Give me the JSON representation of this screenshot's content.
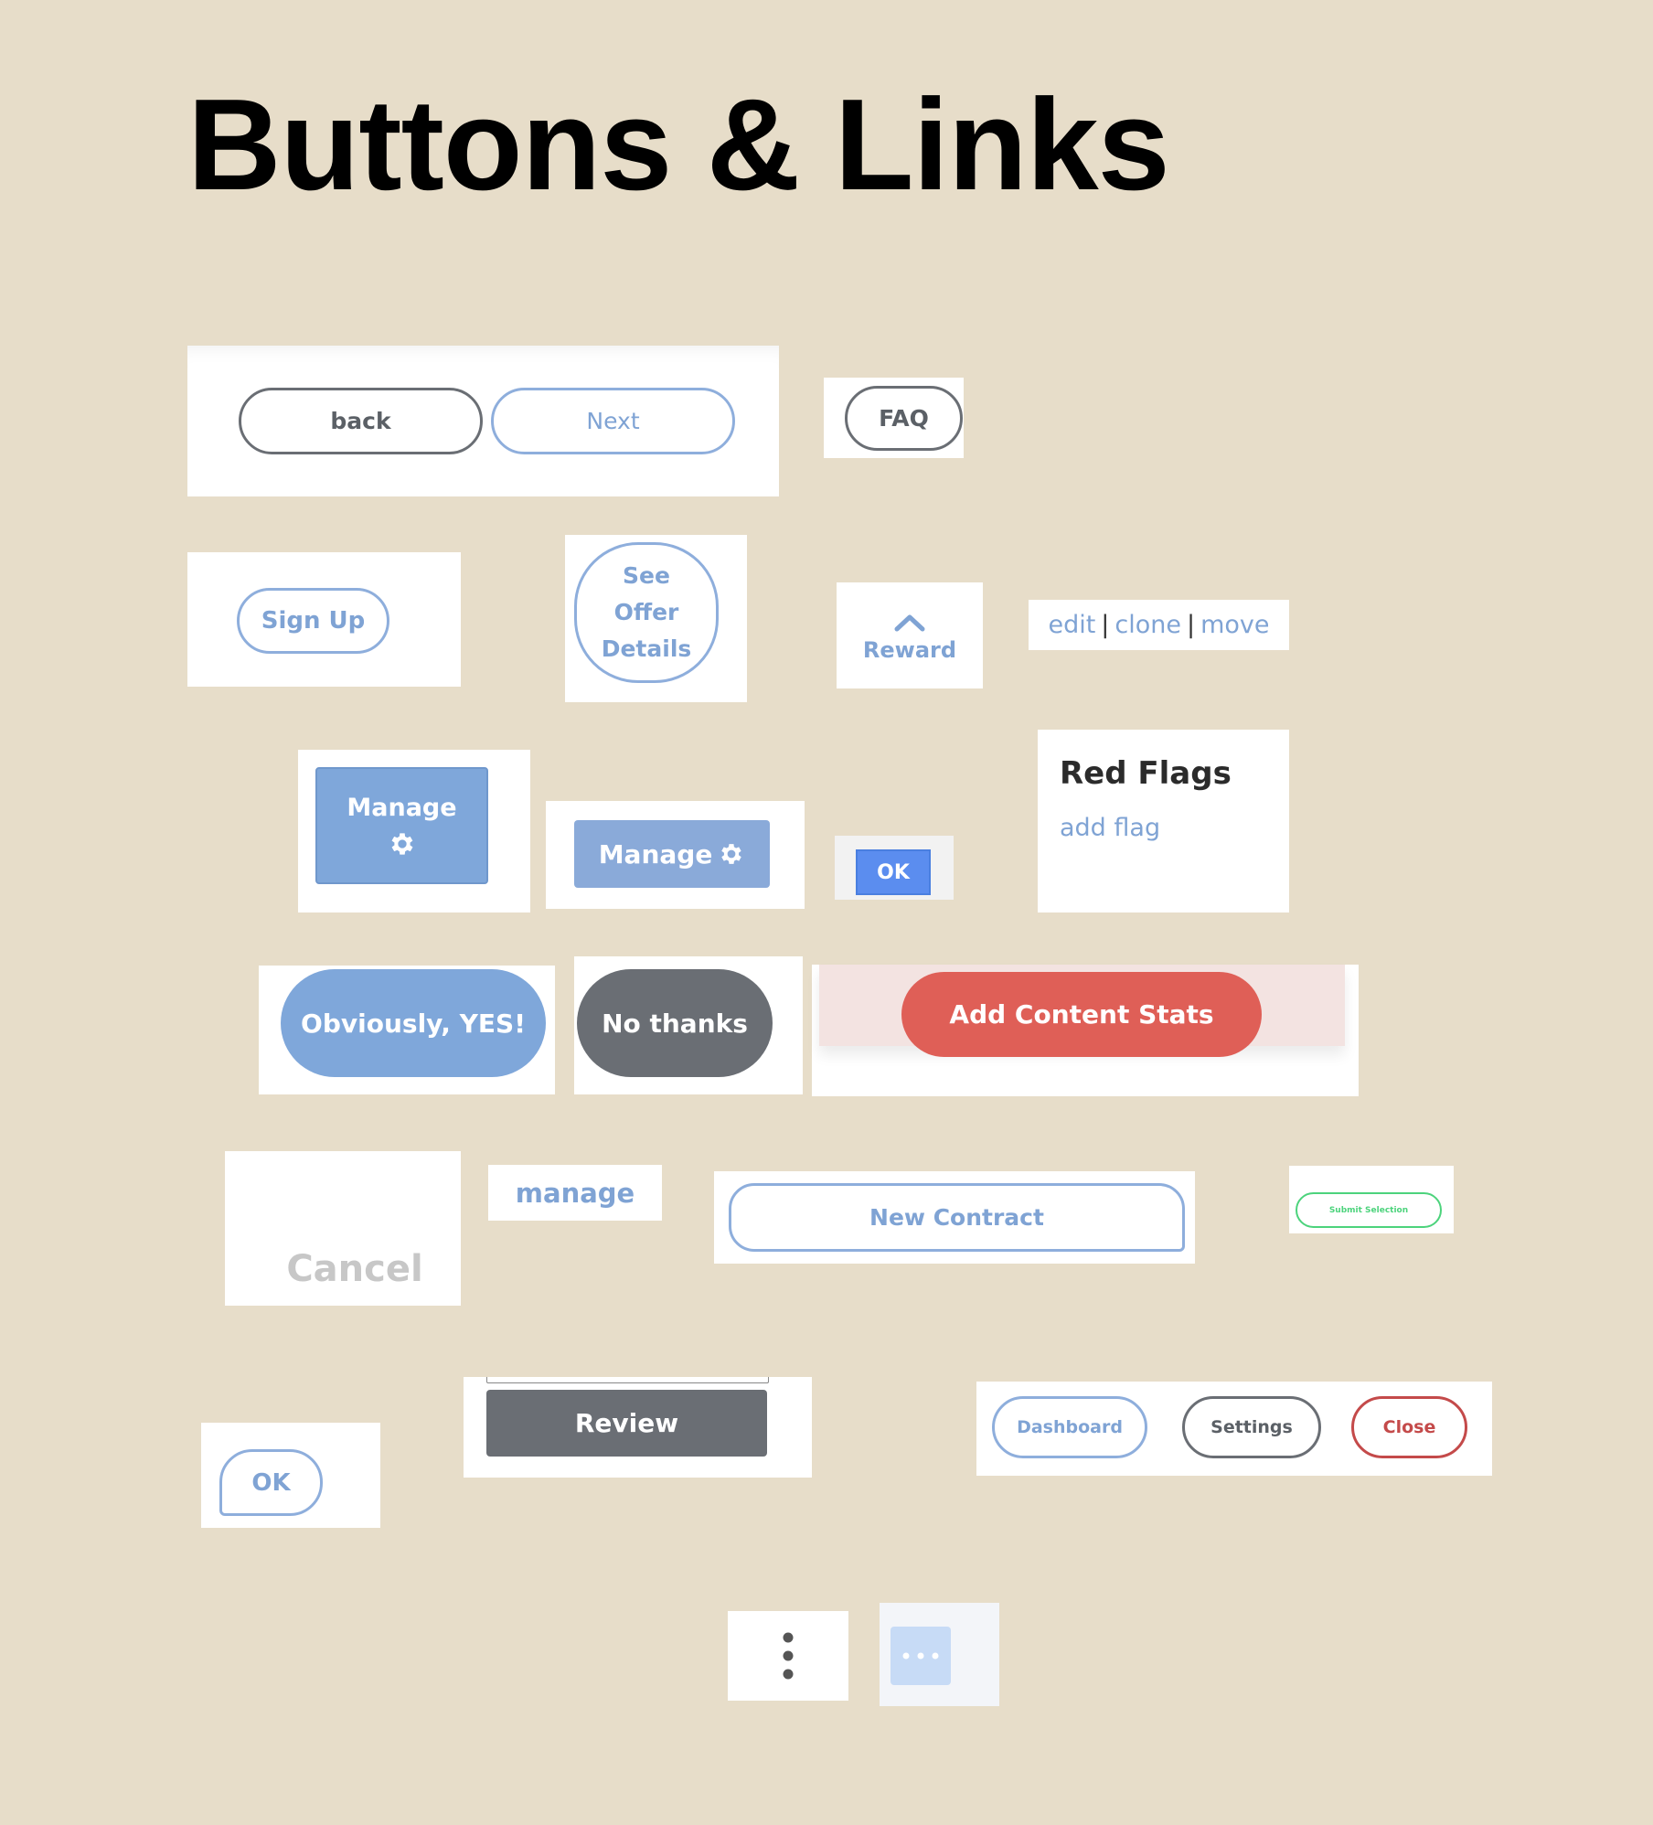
{
  "title": "Buttons & Links",
  "nav": {
    "back": "back",
    "next": "Next"
  },
  "faq": "FAQ",
  "signup": "Sign Up",
  "offer": {
    "line1": "See",
    "line2": "Offer",
    "line3": "Details"
  },
  "reward": {
    "label": "Reward",
    "icon": "chevron-up-icon"
  },
  "edit_links": {
    "edit": "edit",
    "clone": "clone",
    "move": "move",
    "separator": "|"
  },
  "manage_tall": {
    "label": "Manage",
    "icon": "gear-icon"
  },
  "manage_wide": {
    "label": "Manage",
    "icon": "gear-icon"
  },
  "ok_small": "OK",
  "red_flags": {
    "heading": "Red Flags",
    "link": "add flag"
  },
  "obviously_yes": "Obviously, YES!",
  "no_thanks": "No thanks",
  "add_content_stats": "Add Content Stats",
  "cancel": "Cancel",
  "manage_link": "manage",
  "new_contract": "New Contract",
  "submit_selection": "Submit Selection",
  "ok_outline": "OK",
  "review": "Review",
  "tabs": {
    "dashboard": "Dashboard",
    "settings": "Settings",
    "close": "Close"
  },
  "more_vertical": {
    "icon": "vertical-ellipsis-icon"
  },
  "more_horizontal": {
    "icon": "horizontal-ellipsis-icon"
  },
  "colors": {
    "background": "#e7ddc9",
    "blue": "#7fa3d4",
    "gray": "#6a6e74",
    "red": "#df5f57",
    "close_red": "#c44a4a",
    "bright_blue": "#5b8def",
    "green": "#4cd37c"
  }
}
